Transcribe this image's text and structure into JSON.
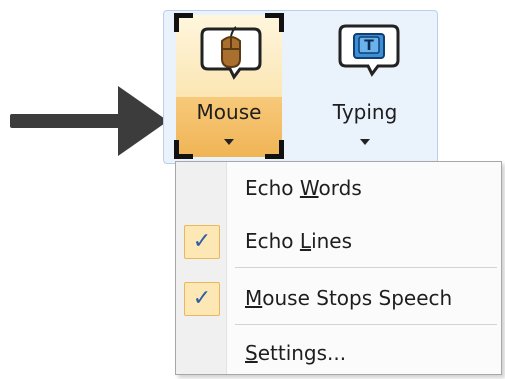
{
  "ribbon": {
    "mouse_button": {
      "label": "Mouse",
      "icon": "mouse-icon",
      "highlight_color": "#f0b455"
    },
    "typing_button": {
      "label": "Typing",
      "icon": "keyboard-t-icon"
    }
  },
  "menu": {
    "items": [
      {
        "pre": "Echo ",
        "accel": "W",
        "post": "ords",
        "checked": false
      },
      {
        "pre": "Echo ",
        "accel": "L",
        "post": "ines",
        "checked": true
      },
      {
        "pre": "",
        "accel": "M",
        "post": "ouse Stops Speech",
        "checked": true
      },
      {
        "pre": "",
        "accel": "S",
        "post": "ettings...",
        "checked": false
      }
    ],
    "check_glyph": "✓"
  },
  "pointer_arrow": {
    "icon": "right-arrow-icon",
    "color": "#3c3c3c"
  }
}
